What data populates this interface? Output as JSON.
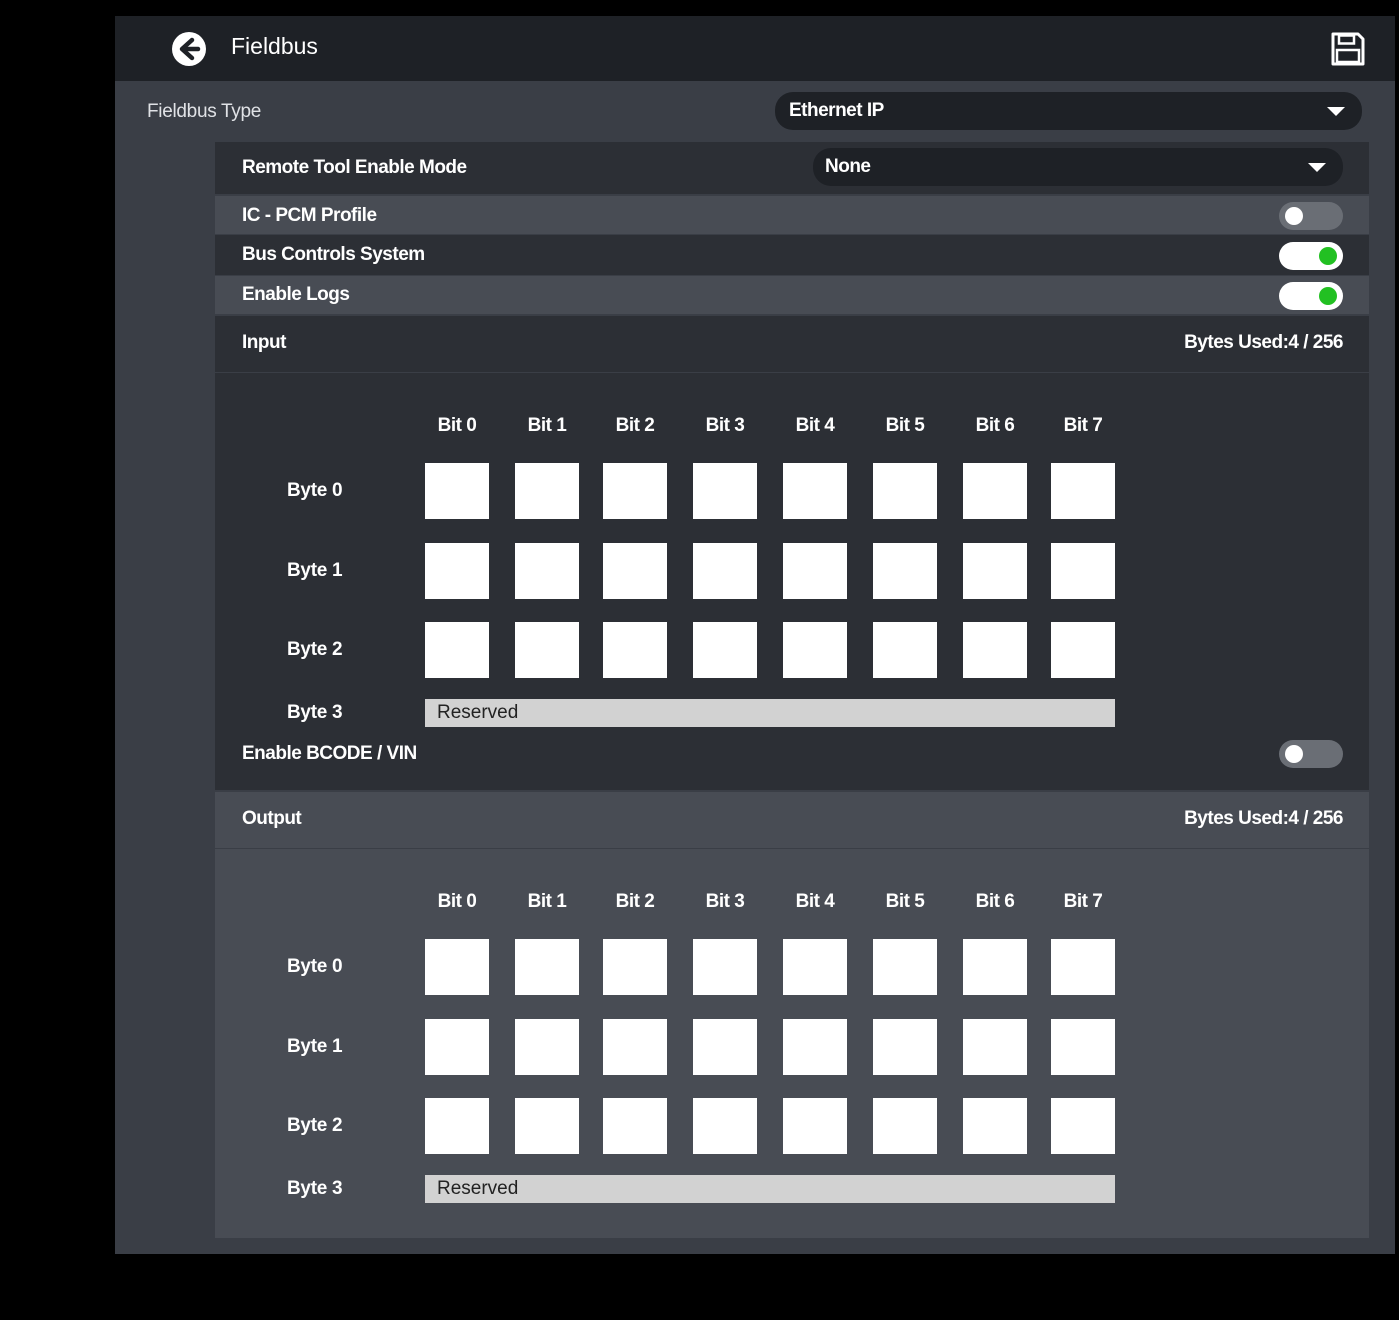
{
  "header": {
    "title": "Fieldbus",
    "back_icon": "arrow-left-circle-icon",
    "save_icon": "floppy-disk-icon"
  },
  "fieldbus_type": {
    "label": "Fieldbus Type",
    "value": "Ethernet IP"
  },
  "remote_tool": {
    "label": "Remote Tool Enable Mode",
    "value": "None"
  },
  "ic_pcm": {
    "label": "IC - PCM Profile",
    "enabled": false
  },
  "bus_controls": {
    "label": "Bus Controls System",
    "enabled": true
  },
  "enable_logs": {
    "label": "Enable Logs",
    "enabled": true
  },
  "input": {
    "title": "Input",
    "bytes_used": "Bytes Used:4 / 256",
    "bits": [
      "Bit 0",
      "Bit 1",
      "Bit 2",
      "Bit 3",
      "Bit 4",
      "Bit 5",
      "Bit 6",
      "Bit 7"
    ],
    "bytes": [
      "Byte 0",
      "Byte 1",
      "Byte 2",
      "Byte 3"
    ],
    "reserved": "Reserved",
    "bcode": {
      "label": "Enable BCODE / VIN",
      "enabled": false
    }
  },
  "output": {
    "title": "Output",
    "bytes_used": "Bytes Used:4 / 256",
    "bits": [
      "Bit 0",
      "Bit 1",
      "Bit 2",
      "Bit 3",
      "Bit 4",
      "Bit 5",
      "Bit 6",
      "Bit 7"
    ],
    "bytes": [
      "Byte 0",
      "Byte 1",
      "Byte 2",
      "Byte 3"
    ],
    "reserved": "Reserved"
  },
  "colors": {
    "toggle_on": "#22c022",
    "header_bg": "#1e2126",
    "panel_bg": "#3a3e46"
  }
}
